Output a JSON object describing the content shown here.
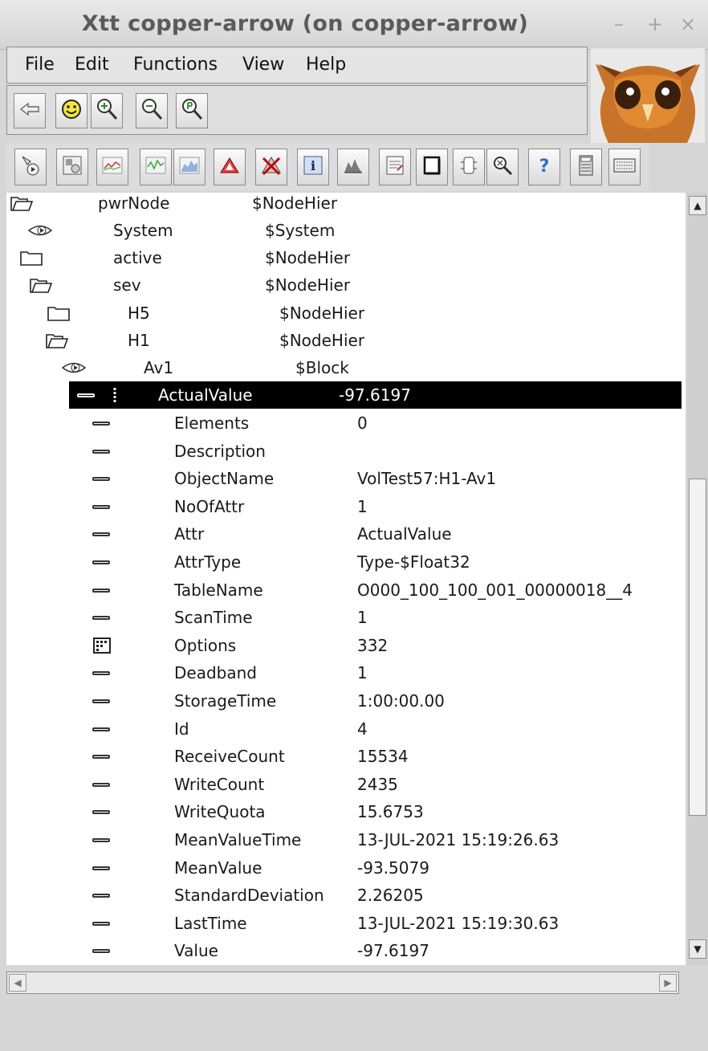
{
  "window": {
    "title": "Xtt copper-arrow (on copper-arrow)",
    "controls": [
      "–",
      "+",
      "×"
    ]
  },
  "menu": [
    "File",
    "Edit",
    "Functions",
    "View",
    "Help"
  ],
  "toolbar1": [
    {
      "icon": "back-arrow-icon"
    },
    {
      "icon": "smiley-icon"
    },
    {
      "icon": "zoom-in-icon"
    },
    {
      "icon": "zoom-out-icon"
    },
    {
      "icon": "zoom-reset-icon"
    }
  ],
  "toolbar2": [
    {
      "icon": "open-object-icon"
    },
    {
      "icon": "open-plc-icon"
    },
    {
      "icon": "trend-icon"
    },
    {
      "icon": "fast-curve-icon"
    },
    {
      "icon": "history-icon"
    },
    {
      "icon": "alarm-icon"
    },
    {
      "icon": "block-events-icon"
    },
    {
      "icon": "info-icon"
    },
    {
      "icon": "crossref-icon"
    },
    {
      "icon": "open-class-icon"
    },
    {
      "icon": "new-window-icon"
    },
    {
      "icon": "object-graph-icon"
    },
    {
      "icon": "search-icon"
    },
    {
      "icon": "help-icon"
    },
    {
      "icon": "calculator-icon"
    },
    {
      "icon": "keyboard-icon"
    }
  ],
  "tree": [
    {
      "name": "pwrNode",
      "cls": "$NodeHier",
      "icon": "folder-open",
      "indent": 0
    },
    {
      "name": "System",
      "cls": "$System",
      "icon": "leaf",
      "indent": 1
    },
    {
      "name": "active",
      "cls": "$NodeHier",
      "icon": "folder-closed",
      "indent": 1
    },
    {
      "name": "sev",
      "cls": "$NodeHier",
      "icon": "folder-open",
      "indent": 1
    },
    {
      "name": "H5",
      "cls": "$NodeHier",
      "icon": "folder-closed",
      "indent": 2
    },
    {
      "name": "H1",
      "cls": "$NodeHier",
      "icon": "folder-open",
      "indent": 2
    },
    {
      "name": "Av1",
      "cls": "$Block",
      "icon": "leaf",
      "indent": 3
    }
  ],
  "selected": {
    "name": "ActualValue",
    "value": "-97.6197"
  },
  "attributes": [
    {
      "name": "Elements",
      "value": "0",
      "icon": "attr"
    },
    {
      "name": "Description",
      "value": "",
      "icon": "attr"
    },
    {
      "name": "ObjectName",
      "value": "VolTest57:H1-Av1",
      "icon": "attr"
    },
    {
      "name": "NoOfAttr",
      "value": "1",
      "icon": "attr"
    },
    {
      "name": "Attr",
      "value": "ActualValue",
      "icon": "attr"
    },
    {
      "name": "AttrType",
      "value": "Type-$Float32",
      "icon": "attr"
    },
    {
      "name": "TableName",
      "value": "O000_100_100_001_00000018__4",
      "icon": "attr"
    },
    {
      "name": "ScanTime",
      "value": "1",
      "icon": "attr"
    },
    {
      "name": "Options",
      "value": "332",
      "icon": "bitmask"
    },
    {
      "name": "Deadband",
      "value": "1",
      "icon": "attr"
    },
    {
      "name": "StorageTime",
      "value": "1:00:00.00",
      "icon": "attr"
    },
    {
      "name": "Id",
      "value": "4",
      "icon": "attr"
    },
    {
      "name": "ReceiveCount",
      "value": "15534",
      "icon": "attr"
    },
    {
      "name": "WriteCount",
      "value": "2435",
      "icon": "attr"
    },
    {
      "name": "WriteQuota",
      "value": "15.6753",
      "icon": "attr"
    },
    {
      "name": "MeanValueTime",
      "value": "13-JUL-2021 15:19:26.63",
      "icon": "attr"
    },
    {
      "name": "MeanValue",
      "value": "-93.5079",
      "icon": "attr"
    },
    {
      "name": "StandardDeviation",
      "value": "2.26205",
      "icon": "attr"
    },
    {
      "name": "LastTime",
      "value": "13-JUL-2021 15:19:30.63",
      "icon": "attr"
    },
    {
      "name": "Value",
      "value": "-97.6197",
      "icon": "attr"
    }
  ],
  "scrollbars": {
    "up": "▲",
    "down": "▼",
    "left": "◀",
    "right": "▶"
  }
}
